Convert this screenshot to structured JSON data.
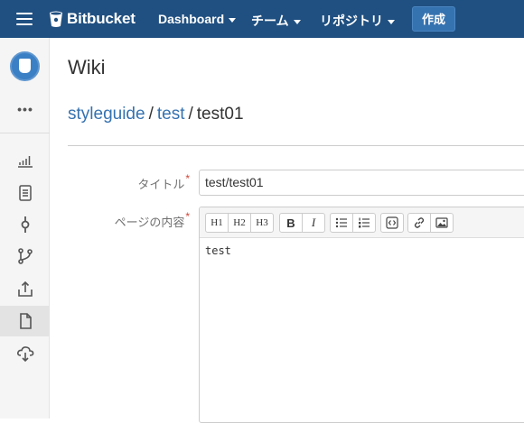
{
  "header": {
    "brand": "Bitbucket",
    "nav": [
      {
        "label": "Dashboard"
      },
      {
        "label": "チーム"
      },
      {
        "label": "リポジトリ"
      }
    ],
    "create_label": "作成",
    "brand_color": "#205081"
  },
  "sidebar": {
    "more_label": "•••",
    "items": [
      {
        "icon": "stats-icon"
      },
      {
        "icon": "source-icon"
      },
      {
        "icon": "commits-icon"
      },
      {
        "icon": "branches-icon"
      },
      {
        "icon": "pull-requests-icon"
      },
      {
        "icon": "wiki-icon",
        "active": true
      },
      {
        "icon": "downloads-icon"
      }
    ]
  },
  "page": {
    "title": "Wiki",
    "breadcrumb": [
      "styleguide",
      "test",
      "test01"
    ],
    "breadcrumb_sep": "/"
  },
  "form": {
    "title_label": "タイトル",
    "title_value": "test/test01",
    "content_label": "ページの内容",
    "required_mark": "*",
    "content_value": "test",
    "toolbar": {
      "headings": [
        "H1",
        "H2",
        "H3"
      ],
      "bold": "B",
      "italic": "I"
    }
  }
}
